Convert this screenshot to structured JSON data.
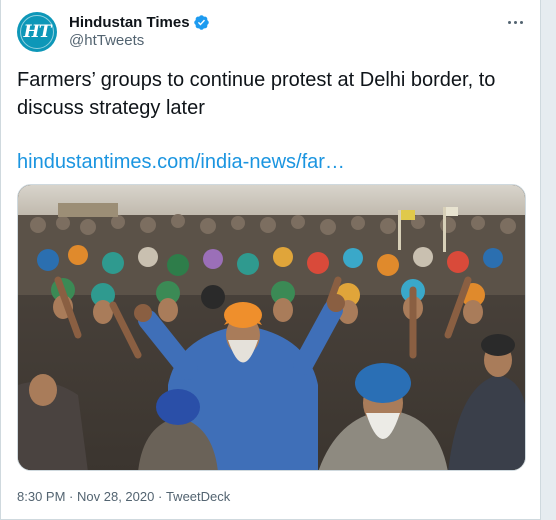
{
  "tweet": {
    "author": {
      "display_name": "Hindustan Times",
      "handle": "@htTweets",
      "verified": true,
      "avatar_text": "HT",
      "avatar_color": "#0d97b8"
    },
    "text": "Farmers’ groups to continue protest at Delhi border, to discuss strategy later",
    "link_text": "hindustantimes.com/india-news/far…",
    "link_color": "#1b95e0",
    "image_icon": "protest-photo-image",
    "time": "8:30 PM",
    "date": "Nov 28, 2020",
    "separator": "·",
    "source": "TweetDeck"
  }
}
